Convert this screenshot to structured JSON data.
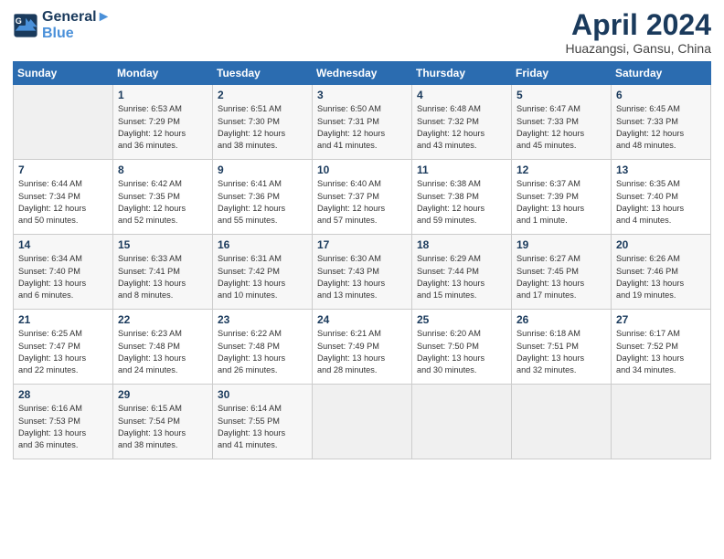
{
  "logo": {
    "line1": "General",
    "line2": "Blue"
  },
  "title": "April 2024",
  "subtitle": "Huazangsi, Gansu, China",
  "days_header": [
    "Sunday",
    "Monday",
    "Tuesday",
    "Wednesday",
    "Thursday",
    "Friday",
    "Saturday"
  ],
  "weeks": [
    [
      {
        "day": "",
        "lines": []
      },
      {
        "day": "1",
        "lines": [
          "Sunrise: 6:53 AM",
          "Sunset: 7:29 PM",
          "Daylight: 12 hours",
          "and 36 minutes."
        ]
      },
      {
        "day": "2",
        "lines": [
          "Sunrise: 6:51 AM",
          "Sunset: 7:30 PM",
          "Daylight: 12 hours",
          "and 38 minutes."
        ]
      },
      {
        "day": "3",
        "lines": [
          "Sunrise: 6:50 AM",
          "Sunset: 7:31 PM",
          "Daylight: 12 hours",
          "and 41 minutes."
        ]
      },
      {
        "day": "4",
        "lines": [
          "Sunrise: 6:48 AM",
          "Sunset: 7:32 PM",
          "Daylight: 12 hours",
          "and 43 minutes."
        ]
      },
      {
        "day": "5",
        "lines": [
          "Sunrise: 6:47 AM",
          "Sunset: 7:33 PM",
          "Daylight: 12 hours",
          "and 45 minutes."
        ]
      },
      {
        "day": "6",
        "lines": [
          "Sunrise: 6:45 AM",
          "Sunset: 7:33 PM",
          "Daylight: 12 hours",
          "and 48 minutes."
        ]
      }
    ],
    [
      {
        "day": "7",
        "lines": [
          "Sunrise: 6:44 AM",
          "Sunset: 7:34 PM",
          "Daylight: 12 hours",
          "and 50 minutes."
        ]
      },
      {
        "day": "8",
        "lines": [
          "Sunrise: 6:42 AM",
          "Sunset: 7:35 PM",
          "Daylight: 12 hours",
          "and 52 minutes."
        ]
      },
      {
        "day": "9",
        "lines": [
          "Sunrise: 6:41 AM",
          "Sunset: 7:36 PM",
          "Daylight: 12 hours",
          "and 55 minutes."
        ]
      },
      {
        "day": "10",
        "lines": [
          "Sunrise: 6:40 AM",
          "Sunset: 7:37 PM",
          "Daylight: 12 hours",
          "and 57 minutes."
        ]
      },
      {
        "day": "11",
        "lines": [
          "Sunrise: 6:38 AM",
          "Sunset: 7:38 PM",
          "Daylight: 12 hours",
          "and 59 minutes."
        ]
      },
      {
        "day": "12",
        "lines": [
          "Sunrise: 6:37 AM",
          "Sunset: 7:39 PM",
          "Daylight: 13 hours",
          "and 1 minute."
        ]
      },
      {
        "day": "13",
        "lines": [
          "Sunrise: 6:35 AM",
          "Sunset: 7:40 PM",
          "Daylight: 13 hours",
          "and 4 minutes."
        ]
      }
    ],
    [
      {
        "day": "14",
        "lines": [
          "Sunrise: 6:34 AM",
          "Sunset: 7:40 PM",
          "Daylight: 13 hours",
          "and 6 minutes."
        ]
      },
      {
        "day": "15",
        "lines": [
          "Sunrise: 6:33 AM",
          "Sunset: 7:41 PM",
          "Daylight: 13 hours",
          "and 8 minutes."
        ]
      },
      {
        "day": "16",
        "lines": [
          "Sunrise: 6:31 AM",
          "Sunset: 7:42 PM",
          "Daylight: 13 hours",
          "and 10 minutes."
        ]
      },
      {
        "day": "17",
        "lines": [
          "Sunrise: 6:30 AM",
          "Sunset: 7:43 PM",
          "Daylight: 13 hours",
          "and 13 minutes."
        ]
      },
      {
        "day": "18",
        "lines": [
          "Sunrise: 6:29 AM",
          "Sunset: 7:44 PM",
          "Daylight: 13 hours",
          "and 15 minutes."
        ]
      },
      {
        "day": "19",
        "lines": [
          "Sunrise: 6:27 AM",
          "Sunset: 7:45 PM",
          "Daylight: 13 hours",
          "and 17 minutes."
        ]
      },
      {
        "day": "20",
        "lines": [
          "Sunrise: 6:26 AM",
          "Sunset: 7:46 PM",
          "Daylight: 13 hours",
          "and 19 minutes."
        ]
      }
    ],
    [
      {
        "day": "21",
        "lines": [
          "Sunrise: 6:25 AM",
          "Sunset: 7:47 PM",
          "Daylight: 13 hours",
          "and 22 minutes."
        ]
      },
      {
        "day": "22",
        "lines": [
          "Sunrise: 6:23 AM",
          "Sunset: 7:48 PM",
          "Daylight: 13 hours",
          "and 24 minutes."
        ]
      },
      {
        "day": "23",
        "lines": [
          "Sunrise: 6:22 AM",
          "Sunset: 7:48 PM",
          "Daylight: 13 hours",
          "and 26 minutes."
        ]
      },
      {
        "day": "24",
        "lines": [
          "Sunrise: 6:21 AM",
          "Sunset: 7:49 PM",
          "Daylight: 13 hours",
          "and 28 minutes."
        ]
      },
      {
        "day": "25",
        "lines": [
          "Sunrise: 6:20 AM",
          "Sunset: 7:50 PM",
          "Daylight: 13 hours",
          "and 30 minutes."
        ]
      },
      {
        "day": "26",
        "lines": [
          "Sunrise: 6:18 AM",
          "Sunset: 7:51 PM",
          "Daylight: 13 hours",
          "and 32 minutes."
        ]
      },
      {
        "day": "27",
        "lines": [
          "Sunrise: 6:17 AM",
          "Sunset: 7:52 PM",
          "Daylight: 13 hours",
          "and 34 minutes."
        ]
      }
    ],
    [
      {
        "day": "28",
        "lines": [
          "Sunrise: 6:16 AM",
          "Sunset: 7:53 PM",
          "Daylight: 13 hours",
          "and 36 minutes."
        ]
      },
      {
        "day": "29",
        "lines": [
          "Sunrise: 6:15 AM",
          "Sunset: 7:54 PM",
          "Daylight: 13 hours",
          "and 38 minutes."
        ]
      },
      {
        "day": "30",
        "lines": [
          "Sunrise: 6:14 AM",
          "Sunset: 7:55 PM",
          "Daylight: 13 hours",
          "and 41 minutes."
        ]
      },
      {
        "day": "",
        "lines": []
      },
      {
        "day": "",
        "lines": []
      },
      {
        "day": "",
        "lines": []
      },
      {
        "day": "",
        "lines": []
      }
    ]
  ]
}
